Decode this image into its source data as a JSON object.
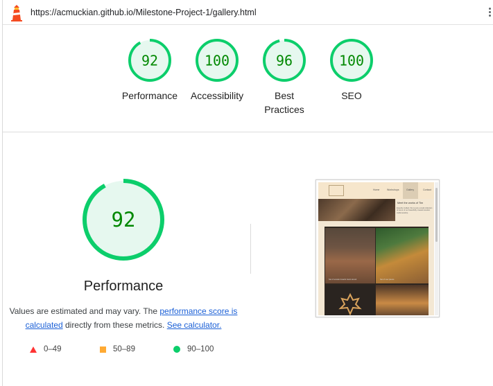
{
  "url_bar": {
    "url": "https://acmuckian.github.io/Milestone-Project-1/gallery.html",
    "logo_icon": "lighthouse-icon",
    "menu_icon": "kebab-menu-icon"
  },
  "score_colors": {
    "pass": "#0cce6b",
    "pass_text": "#008800",
    "pass_fill": "#e6f8ef",
    "average": "#ffaa33",
    "fail": "#ff3333"
  },
  "category_gauges": [
    {
      "score": "92",
      "label": "Performance"
    },
    {
      "score": "100",
      "label": "Accessibility"
    },
    {
      "score": "96",
      "label": "Best Practices"
    },
    {
      "score": "100",
      "label": "SEO"
    }
  ],
  "performance": {
    "score": "92",
    "title": "Performance",
    "note_prefix": "Values are estimated and may vary. The ",
    "note_link_score": "performance score is calculated",
    "note_middle": " directly from these metrics. ",
    "note_link_calculator": "See calculator."
  },
  "legend": [
    {
      "icon": "triangle-icon",
      "range": "0–49"
    },
    {
      "icon": "square-icon",
      "range": "50–89"
    },
    {
      "icon": "circle-icon",
      "range": "90–100"
    }
  ],
  "screenshot_thumbnail": {
    "nav_items": [
      "Home",
      "Workshops",
      "Gallery",
      "Contact"
    ],
    "heading": "Meet the works of Tim",
    "paragraph": "Expertly crafted, this is just a small collection of some of our beautifully created wooden craftsmanship.",
    "captions": [
      "Set of wooden boards hand carved",
      "Set of new pieces"
    ]
  }
}
